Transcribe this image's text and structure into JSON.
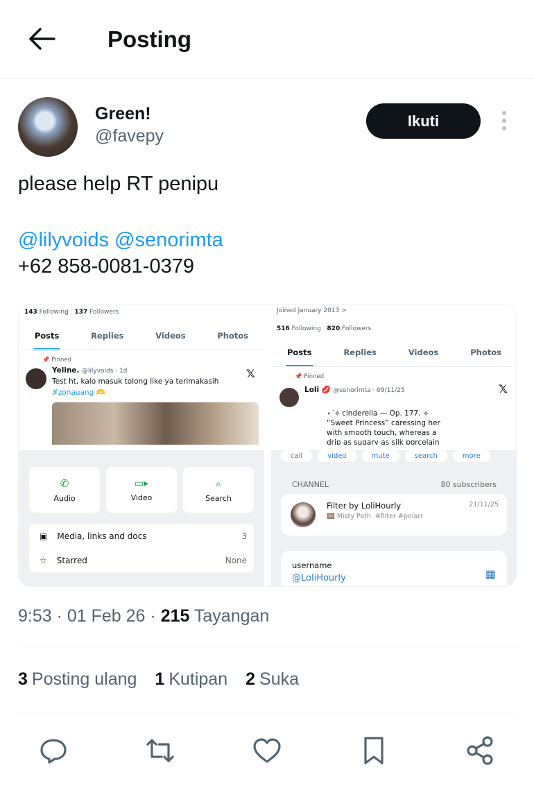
{
  "header": {
    "title": "Posting"
  },
  "author": {
    "display_name": "Green!",
    "handle": "@favepy",
    "follow_label": "Ikuti"
  },
  "post": {
    "text": "please help RT penipu",
    "mentions": [
      "@lilyvoids",
      "@senorimta"
    ],
    "phone": "+62 858-0081-0379"
  },
  "media": {
    "left": {
      "following": "143",
      "following_label": "Following",
      "followers": "137",
      "followers_label": "Followers",
      "tabs": [
        "Posts",
        "Replies",
        "Videos",
        "Photos"
      ],
      "pinned_label": "Pinned",
      "tweet_name": "Yeline.",
      "tweet_meta": "@lilyvoids · 1d",
      "tweet_text": "Test ht, kalo masuk tolong like ya terimakasih",
      "tweet_hashtag": "#zonauang 🫶",
      "contact_buttons": [
        "Audio",
        "Video",
        "Search"
      ],
      "rows": [
        {
          "label": "Media, links and docs",
          "value": "3"
        },
        {
          "label": "Starred",
          "value": "None"
        }
      ]
    },
    "right": {
      "joined": "Joined January 2013 >",
      "following": "516",
      "following_label": "Following",
      "followers": "820",
      "followers_label": "Followers",
      "tabs": [
        "Posts",
        "Replies",
        "Videos",
        "Photos"
      ],
      "pinned_label": "Pinned",
      "tweet_name": "Loli 💋",
      "tweet_meta": "@senorimta · 09/11/25",
      "tweet_line1": "⋆˙⟡  cinderella  —  Op. 177.  ⟢",
      "tweet_line2": "“Sweet Princess” caressing  her",
      "tweet_line3": "with smooth  touch,  whereas a",
      "tweet_line4": "drip as sugary  as  silk porcelain",
      "pill_buttons": [
        "call",
        "video",
        "mute",
        "search",
        "more"
      ],
      "channel_label": "CHANNEL",
      "subscribers": "80 subscribers",
      "channel_title": "Filter by LoliHourly",
      "channel_date": "21/11/25",
      "channel_sub": "🎞️ Misty Path. #filter #polarr",
      "username_label": "username",
      "username_value": "@LoliHourly"
    }
  },
  "meta": {
    "time": "9:53 · 01 Feb 26 · ",
    "views": "215",
    "views_label": "Tayangan"
  },
  "stats": {
    "reposts": "3",
    "reposts_label": "Posting ulang",
    "quotes": "1",
    "quotes_label": "Kutipan",
    "likes": "2",
    "likes_label": "Suka"
  },
  "icons": [
    "back-arrow-icon",
    "more-vertical-icon",
    "reply-icon",
    "repost-icon",
    "like-icon",
    "bookmark-icon",
    "share-icon"
  ],
  "colors": {
    "accent": "#1d9bf0",
    "text": "#0f1419",
    "muted": "#536471",
    "follow_bg": "#0f1419"
  }
}
